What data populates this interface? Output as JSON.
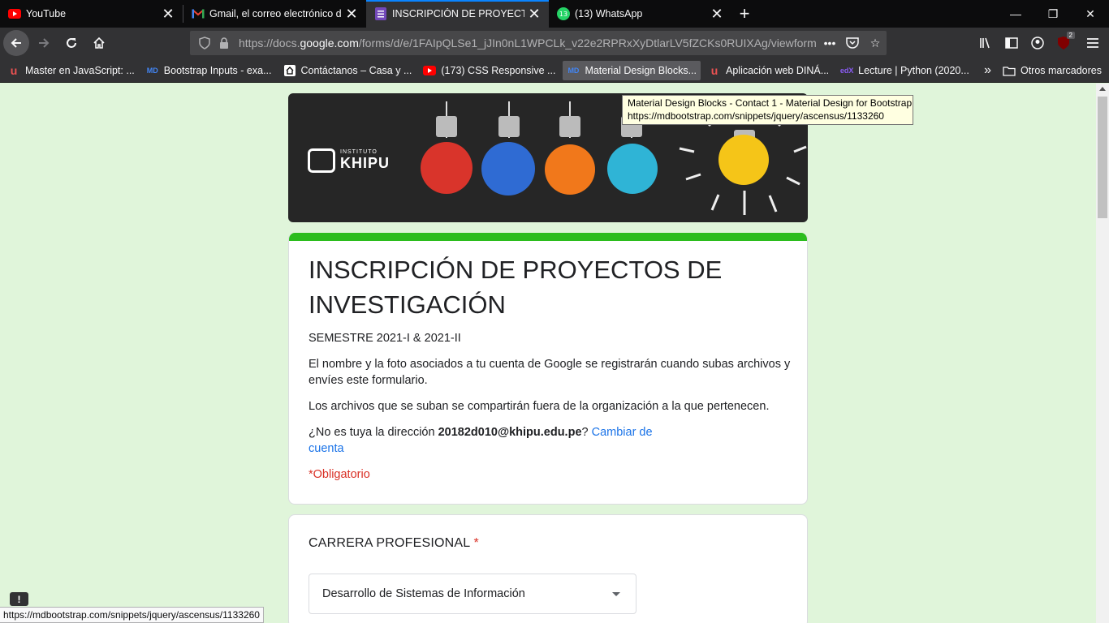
{
  "tabs": [
    {
      "title": "YouTube",
      "icon": "youtube-icon",
      "active": false
    },
    {
      "title": "Gmail, el correo electrónico de Google",
      "icon": "gmail-icon",
      "active": false
    },
    {
      "title": "INSCRIPCIÓN DE PROYECTOS DE INVESTIGACIÓN",
      "icon": "forms-icon",
      "active": true
    },
    {
      "title": "(13) WhatsApp",
      "icon": "whatsapp-icon",
      "badge": "13",
      "active": false
    }
  ],
  "window": {
    "minimize": "—",
    "restore": "❐",
    "close": "✕"
  },
  "nav": {
    "url_prefix": "https://docs.",
    "url_domain": "google.com",
    "url_rest": "/forms/d/e/1FAIpQLSe1_jJIn0nL1WPCLk_v22e2RPRxXyDtlarLV5fZCKs0RUIXAg/viewform",
    "ublock_badge": "2"
  },
  "bookmarks": [
    {
      "label": "Master en JavaScript: ...",
      "icon": "udemy-icon"
    },
    {
      "label": "Bootstrap Inputs - exa...",
      "icon": "mdb-icon"
    },
    {
      "label": "Contáctanos – Casa y ...",
      "icon": "casa-icon"
    },
    {
      "label": "(173) CSS Responsive ...",
      "icon": "youtube-icon"
    },
    {
      "label": "Material Design Blocks...",
      "icon": "mdb-icon"
    },
    {
      "label": "Aplicación web DINÁ...",
      "icon": "udemy-icon"
    },
    {
      "label": "Lecture | Python (2020...",
      "icon": "edx-icon"
    }
  ],
  "bookmarks_other": "Otros marcadores",
  "banner": {
    "logo_small": "INSTITUTO",
    "logo_big": "KHIPU"
  },
  "form": {
    "title": "INSCRIPCIÓN DE PROYECTOS DE INVESTIGACIÓN",
    "semester": "SEMESTRE 2021-I & 2021-II",
    "notice1": "El nombre y la foto asociados a tu cuenta de Google se registrarán cuando subas archivos y envíes este formulario.",
    "notice2": "Los archivos que se suban se compartirán fuera de la organización a la que pertenecen.",
    "account_prefix": "¿No es tuya la dirección ",
    "account_email": "20182d010@khipu.edu.pe",
    "account_suffix": "? ",
    "change_account": "Cambiar de cuenta",
    "required_note": "*Obligatorio"
  },
  "question": {
    "title": "CARRERA PROFESIONAL",
    "required_mark": "*",
    "selected": "Desarrollo de Sistemas de Información"
  },
  "tooltip": {
    "line1": "Material Design Blocks - Contact 1 - Material Design for Bootstrap",
    "line2": "https://mdbootstrap.com/snippets/jquery/ascensus/1133260"
  },
  "status_url": "https://mdbootstrap.com/snippets/jquery/ascensus/1133260",
  "colors": {
    "accent": "#2bbd1d",
    "link": "#1a73e8",
    "required": "#d93025",
    "page_bg": "#e0f5da"
  }
}
